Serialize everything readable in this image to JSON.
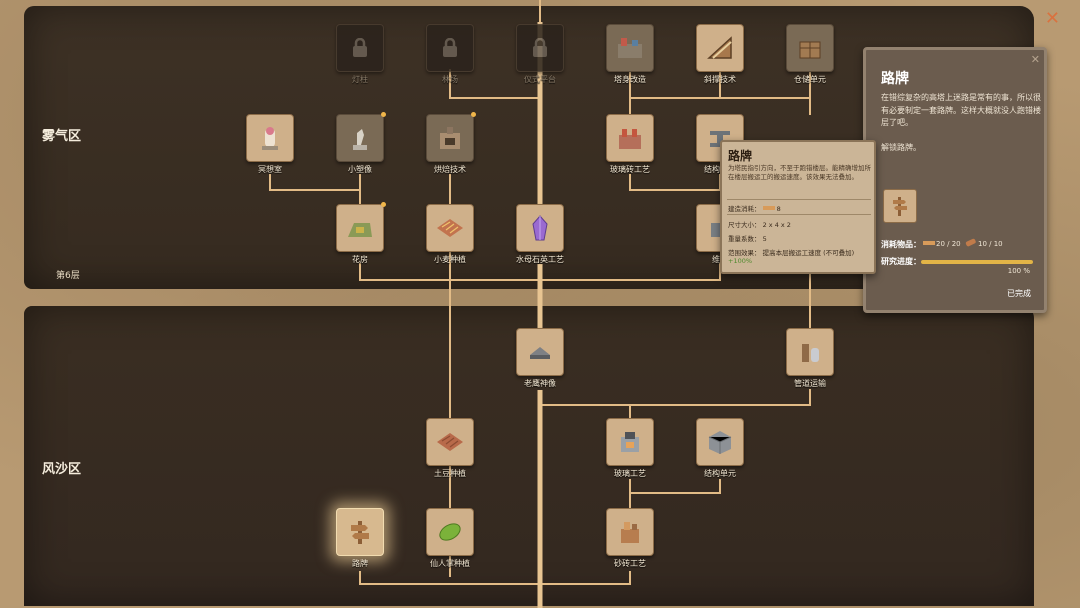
{
  "zones": {
    "mist": "雾气区",
    "sandstorm": "风沙区"
  },
  "floor_label": "第6层",
  "nodes": {
    "lamppost": {
      "label": "灯柱",
      "icon": "lock-icon",
      "state": "locked"
    },
    "lumberyard": {
      "label": "林场",
      "icon": "lock-icon",
      "state": "locked"
    },
    "ritual_platform": {
      "label": "仪式平台",
      "icon": "lock-icon",
      "state": "locked"
    },
    "tower_remodel": {
      "label": "塔身改造",
      "icon": "tower-remodel-icon",
      "state": "available"
    },
    "ramp_tech": {
      "label": "斜撑技术",
      "icon": "ramp-icon",
      "state": "researched"
    },
    "storage_unit": {
      "label": "仓储单元",
      "icon": "storage-icon",
      "state": "available"
    },
    "meditation_room": {
      "label": "冥想室",
      "icon": "meditation-icon",
      "state": "researched"
    },
    "small_statue": {
      "label": "小塑像",
      "icon": "statue-icon",
      "state": "available"
    },
    "baking_tech": {
      "label": "烘焙技术",
      "icon": "oven-icon",
      "state": "available"
    },
    "glass_brick": {
      "label": "玻璃砖工艺",
      "icon": "glass-brick-icon",
      "state": "researched"
    },
    "structure_reinforce": {
      "label": "结构强化",
      "icon": "beam-icon",
      "state": "researched"
    },
    "greenhouse": {
      "label": "花房",
      "icon": "greenhouse-icon",
      "state": "researched"
    },
    "wheat_farm": {
      "label": "小麦种植",
      "icon": "wheat-field-icon",
      "state": "researched"
    },
    "crystal_craft": {
      "label": "水母石英工艺",
      "icon": "crystal-icon",
      "state": "researched"
    },
    "maintenance": {
      "label": "维修",
      "icon": "maintenance-icon",
      "state": "researched"
    },
    "eagle_statue": {
      "label": "老鹰神像",
      "icon": "eagle-statue-icon",
      "state": "researched"
    },
    "pipe_transport": {
      "label": "管道运输",
      "icon": "pipe-icon",
      "state": "researched"
    },
    "potato_farm": {
      "label": "土豆种植",
      "icon": "potato-field-icon",
      "state": "researched"
    },
    "glass_craft": {
      "label": "玻璃工艺",
      "icon": "glass-kiln-icon",
      "state": "researched"
    },
    "structure_unit": {
      "label": "结构单元",
      "icon": "cube-icon",
      "state": "researched"
    },
    "signpost": {
      "label": "路牌",
      "icon": "signpost-icon",
      "state": "selected"
    },
    "cactus_farm": {
      "label": "仙人掌种植",
      "icon": "cactus-icon",
      "state": "researched"
    },
    "sandbrick_craft": {
      "label": "砂砖工艺",
      "icon": "sandbrick-icon",
      "state": "researched"
    }
  },
  "detail": {
    "title": "路牌",
    "description": "在错综复杂的高塔上迷路是常有的事，所以很有必要制定一套路牌。这样大概就没人跑错楼层了吧。",
    "unlock": "解锁路牌。",
    "cost_label": "消耗物品：",
    "cost_items": [
      {
        "icon": "plank-icon",
        "value": "20 / 20"
      },
      {
        "icon": "log-icon",
        "value": "10 / 10"
      }
    ],
    "progress_label": "研究进度：",
    "progress_value": 1.0,
    "progress_text": "100 %",
    "status": "已完成"
  },
  "tooltip": {
    "title": "路牌",
    "description": "为塔民指引方向，不至于跑错楼层。能精确增加所在楼层搬运工的搬运速度。该效果无法叠加。",
    "cost_label": "建造消耗：",
    "cost_value": "8",
    "size_label": "尺寸大小：",
    "size_value": "2 x 4 x 2",
    "weight_label": "重量系数：",
    "weight_value": "5",
    "range_label": "范围效果：",
    "range_value": "提高本层搬运工速度 (不可叠加)",
    "range_bonus": "+100%"
  },
  "colors": {
    "line": "#e2bb86",
    "trunk": "#e8c592",
    "accent": "#f0b64a"
  }
}
